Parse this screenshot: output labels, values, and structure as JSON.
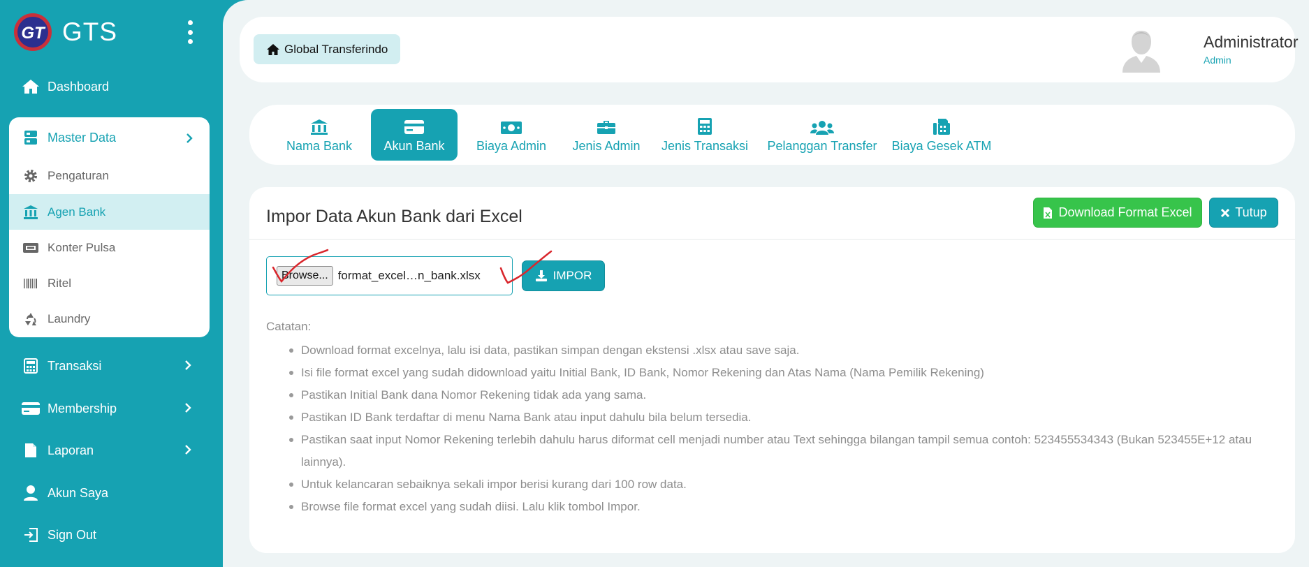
{
  "brand": {
    "name": "GTS",
    "logo_text": "GT"
  },
  "sidebar": {
    "dashboard": "Dashboard",
    "master_data": {
      "label": "Master Data",
      "items": [
        "Pengaturan",
        "Agen Bank",
        "Konter Pulsa",
        "Ritel",
        "Laundry"
      ],
      "active": "Agen Bank"
    },
    "transaksi": "Transaksi",
    "membership": "Membership",
    "laporan": "Laporan",
    "akun_saya": "Akun Saya",
    "sign_out": "Sign Out"
  },
  "topbar": {
    "home_label": "Global Transferindo",
    "user_name": "Administrator",
    "user_role": "Admin"
  },
  "tabs": {
    "items": [
      "Nama Bank",
      "Akun Bank",
      "Biaya Admin",
      "Jenis Admin",
      "Jenis Transaksi",
      "Pelanggan Transfer",
      "Biaya Gesek ATM"
    ],
    "active": "Akun Bank"
  },
  "card": {
    "title": "Impor Data Akun Bank dari Excel",
    "download_label": "Download Format Excel",
    "close_label": "Tutup",
    "browse_label": "Browse...",
    "file_name": "format_excel…n_bank.xlsx",
    "impor_label": "IMPOR",
    "notes_title": "Catatan:",
    "notes": [
      "Download format excelnya, lalu isi data, pastikan simpan dengan ekstensi .xlsx atau save saja.",
      "Isi file format excel yang sudah didownload yaitu Initial Bank, ID Bank, Nomor Rekening dan Atas Nama (Nama Pemilik Rekening)",
      "Pastikan Initial Bank dana Nomor Rekening tidak ada yang sama.",
      "Pastikan ID Bank terdaftar di menu Nama Bank atau input dahulu bila belum tersedia.",
      "Pastikan saat input Nomor Rekening terlebih dahulu harus diformat cell menjadi number atau Text sehingga bilangan tampil semua contoh: 523455534343 (Bukan 523455E+12 atau lainnya).",
      "Untuk kelancaran sebaiknya sekali impor berisi kurang dari 100 row data.",
      "Browse file format excel yang sudah diisi. Lalu klik tombol Impor."
    ]
  },
  "colors": {
    "primary": "#16a2b2",
    "success": "#37c44b",
    "background": "#eef4f5",
    "active_light": "#d2eff2",
    "annotation": "#d9262c"
  }
}
